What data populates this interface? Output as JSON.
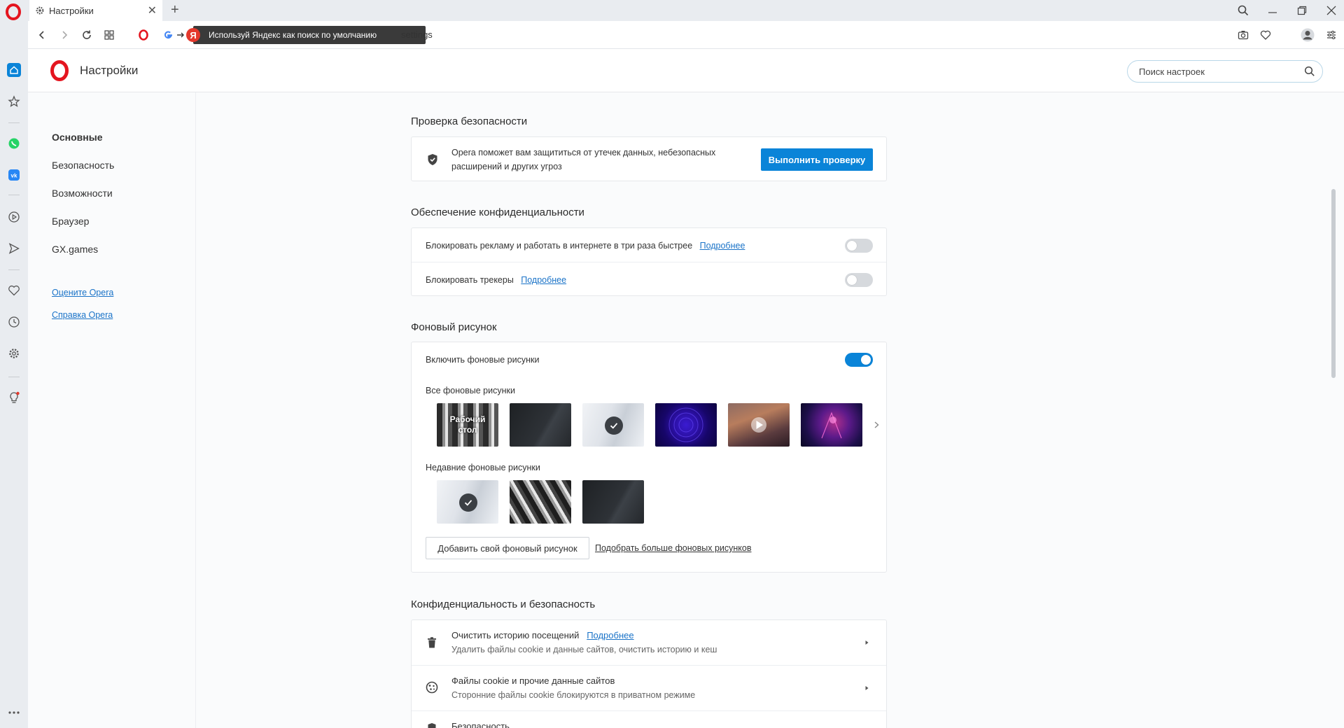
{
  "browser": {
    "tab_title": "Настройки",
    "yandex_tooltip": "Используй Яндекс как поиск по умолчанию",
    "yandex_badge": "Я",
    "url": "settings",
    "accent_color": "#0a84d8",
    "brand_color": "#e4151f"
  },
  "header": {
    "title": "Настройки",
    "search_placeholder": "Поиск настроек"
  },
  "nav": {
    "items": [
      {
        "label": "Основные",
        "active": true
      },
      {
        "label": "Безопасность",
        "active": false
      },
      {
        "label": "Возможности",
        "active": false
      },
      {
        "label": "Браузер",
        "active": false
      },
      {
        "label": "GX.games",
        "active": false
      }
    ],
    "links": [
      "Оцените Opera",
      "Справка Opera"
    ]
  },
  "safety_check": {
    "title": "Проверка безопасности",
    "text_line1": "Opera поможет вам защититься от утечек данных, небезопасных",
    "text_line2": "расширений и других угроз",
    "button": "Выполнить проверку"
  },
  "privacy": {
    "title": "Обеспечение конфиденциальности",
    "rows": [
      {
        "text": "Блокировать рекламу и работать в интернете в три раза быстрее",
        "link": "Подробнее",
        "enabled": false
      },
      {
        "text": "Блокировать трекеры",
        "link": "Подробнее",
        "enabled": false
      }
    ]
  },
  "wallpaper": {
    "title": "Фоновый рисунок",
    "enable_label": "Включить фоновые рисунки",
    "enabled": true,
    "all_label": "Все фоновые рисунки",
    "desktop_label_line1": "Рабочий",
    "desktop_label_line2": "стол",
    "recent_label": "Недавние фоновые рисунки",
    "add_button": "Добавить свой фоновый рисунок",
    "more_link": "Подобрать больше фоновых рисунков"
  },
  "privacy_security": {
    "title": "Конфиденциальность и безопасность",
    "rows": [
      {
        "title": "Очистить историю посещений",
        "link": "Подробнее",
        "subtitle": "Удалить файлы cookie и данные сайтов, очистить историю и кеш",
        "icon": "trash-icon"
      },
      {
        "title": "Файлы cookie и прочие данные сайтов",
        "link": "",
        "subtitle": "Сторонние файлы cookie блокируются в приватном режиме",
        "icon": "cookie-icon"
      },
      {
        "title": "Безопасность",
        "link": "",
        "subtitle": "",
        "icon": "shield-icon"
      }
    ]
  }
}
